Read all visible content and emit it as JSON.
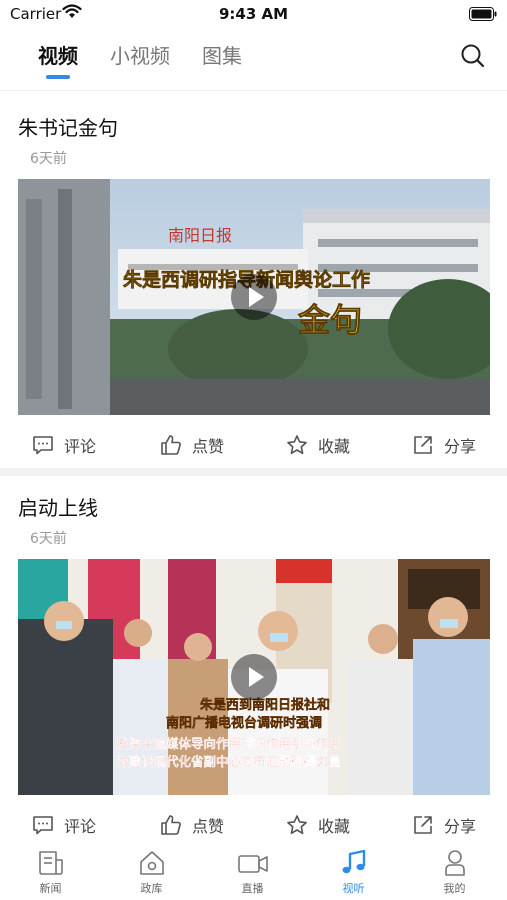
{
  "status_bar": {
    "carrier": "Carrier",
    "time": "9:43 AM"
  },
  "tabs": [
    {
      "label": "视频",
      "active": true
    },
    {
      "label": "小视频",
      "active": false
    },
    {
      "label": "图集",
      "active": false
    }
  ],
  "feed": [
    {
      "title": "朱书记金句",
      "time": "6天前",
      "overlay": [
        "朱是西调研指导新闻舆论工作",
        "金句"
      ],
      "actions": {
        "comment": "评论",
        "like": "点赞",
        "favorite": "收藏",
        "share": "分享"
      }
    },
    {
      "title": "启动上线",
      "time": "6天前",
      "overlay": [
        "朱是西到南阳日报社和",
        "南阳广播电视台调研时强调",
        "发挥主流媒体导向作用旗帜作用引领作用",
        "为建设现代化省副中心城市汇聚磅礴力量"
      ],
      "actions": {
        "comment": "评论",
        "like": "点赞",
        "favorite": "收藏",
        "share": "分享"
      }
    }
  ],
  "bottom_nav": [
    {
      "label": "新闻",
      "icon": "news-icon",
      "active": false
    },
    {
      "label": "政库",
      "icon": "home-icon",
      "active": false
    },
    {
      "label": "直播",
      "icon": "camera-icon",
      "active": false
    },
    {
      "label": "视听",
      "icon": "music-note-icon",
      "active": true
    },
    {
      "label": "我的",
      "icon": "person-icon",
      "active": false
    }
  ],
  "colors": {
    "accent": "#2f8be6",
    "muted": "#999999",
    "text": "#111111"
  }
}
